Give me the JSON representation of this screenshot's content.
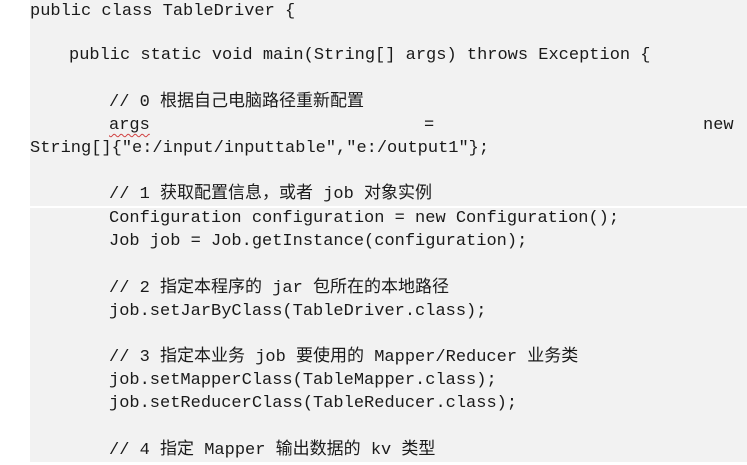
{
  "code": {
    "l1": "public class TableDriver {",
    "l2": "public static void main(String[] args) throws Exception {",
    "l3": "// 0 根据自己电脑路径重新配置",
    "l4a": "args",
    "l4b": "=",
    "l4c": "new",
    "l5": "String[]{\"e:/input/inputtable\",\"e:/output1\"};",
    "l6": "// 1 获取配置信息，或者 job 对象实例",
    "l7": "Configuration configuration = new Configuration();",
    "l8": "Job job = Job.getInstance(configuration);",
    "l9": "// 2 指定本程序的 jar 包所在的本地路径",
    "l10": "job.setJarByClass(TableDriver.class);",
    "l11": "// 3 指定本业务 job 要使用的 Mapper/Reducer 业务类",
    "l12": "job.setMapperClass(TableMapper.class);",
    "l13": "job.setReducerClass(TableReducer.class);",
    "l14": "// 4 指定 Mapper 输出数据的 kv 类型"
  }
}
